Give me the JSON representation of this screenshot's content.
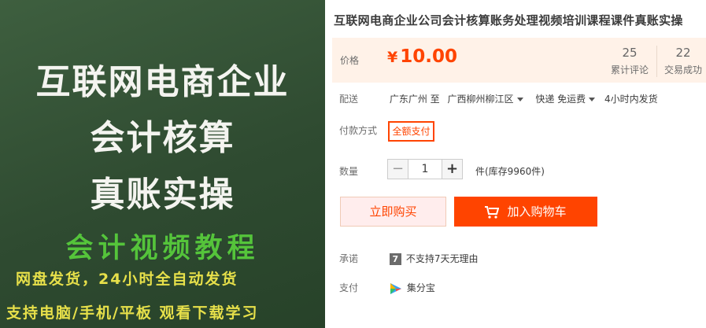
{
  "image": {
    "line1": "互联网电商企业",
    "line2": "会计核算",
    "line3": "真账实操",
    "line4": "会计视频教程",
    "line5": "网盘发货，24小时全自动发货",
    "line6": "支持电脑/手机/平板 观看下载学习"
  },
  "title": "互联网电商企业公司会计核算账务处理视频培训课程课件真账实操",
  "price": {
    "label": "价格",
    "currency": "¥",
    "amount": "10.00",
    "reviews_count": "25",
    "reviews_label": "累计评论",
    "sales_count": "22",
    "sales_label": "交易成功"
  },
  "delivery": {
    "label": "配送",
    "from": "广东广州 至",
    "to": "广西柳州柳江区",
    "method": "快递 免运费",
    "time": "4小时内发货"
  },
  "payment": {
    "label": "付款方式",
    "option": "全额支付"
  },
  "quantity": {
    "label": "数量",
    "minus": "−",
    "value": "1",
    "plus": "+",
    "stock": "件(库存9960件)"
  },
  "actions": {
    "buy_now": "立即购买",
    "add_to_cart": "加入购物车"
  },
  "promise": {
    "label": "承诺",
    "icon_text": "7",
    "text": "不支持7天无理由"
  },
  "pay": {
    "label": "支付",
    "method": "集分宝"
  },
  "colors": {
    "accent": "#ff4400",
    "price_bg": "#fff2e8"
  }
}
